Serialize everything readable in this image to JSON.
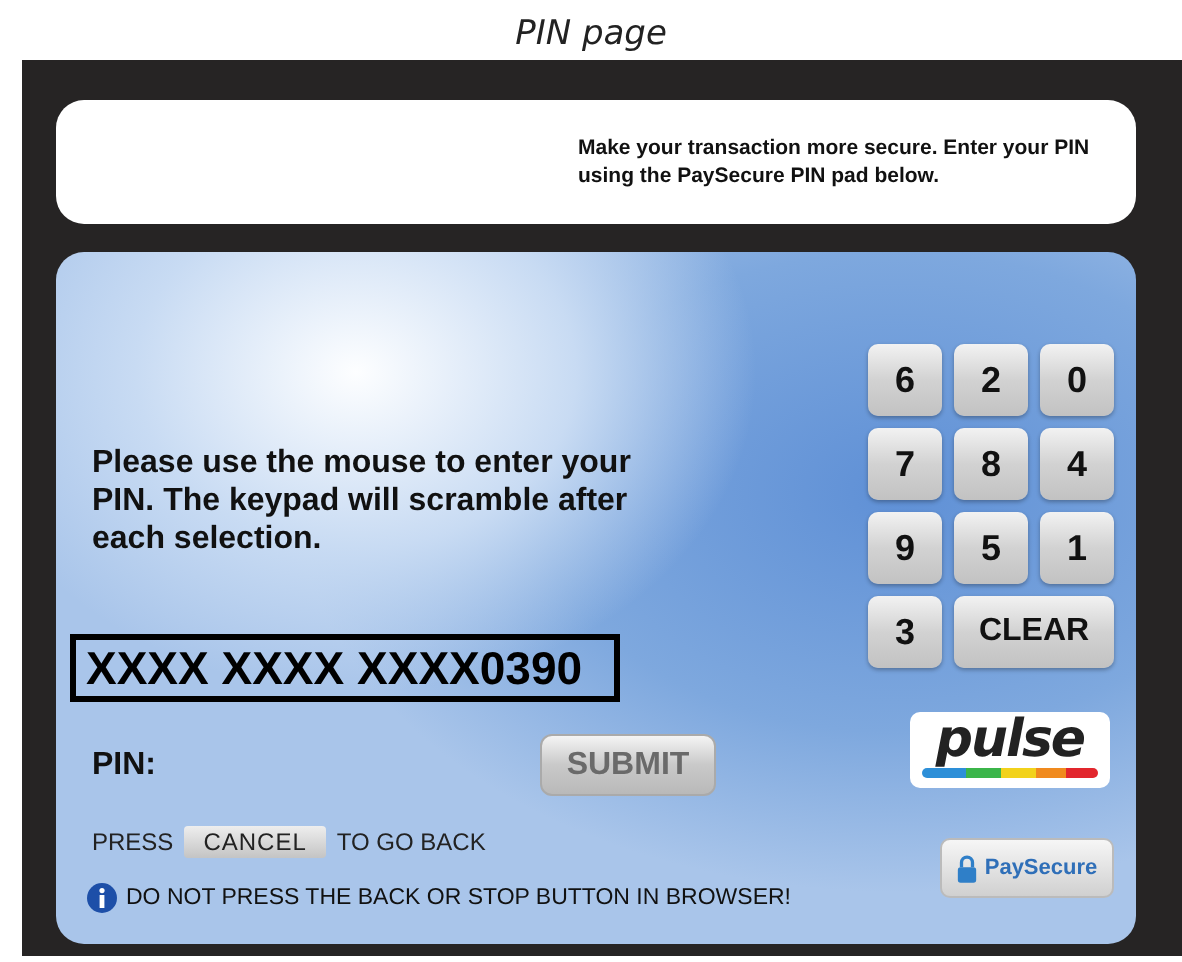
{
  "page_title": "PIN page",
  "notice": "Make your transaction more secure. Enter your PIN using the PaySecure PIN pad below.",
  "instructions": "Please use the mouse to enter your PIN. The keypad will scramble after each selection.",
  "keypad": [
    {
      "label": "6",
      "kind": "digit"
    },
    {
      "label": "2",
      "kind": "digit"
    },
    {
      "label": "0",
      "kind": "digit"
    },
    {
      "label": "7",
      "kind": "digit"
    },
    {
      "label": "8",
      "kind": "digit"
    },
    {
      "label": "4",
      "kind": "digit"
    },
    {
      "label": "9",
      "kind": "digit"
    },
    {
      "label": "5",
      "kind": "digit"
    },
    {
      "label": "1",
      "kind": "digit"
    },
    {
      "label": "3",
      "kind": "digit"
    },
    {
      "label": "CLEAR",
      "kind": "clear"
    }
  ],
  "card_number": "XXXX XXXX XXXX0390",
  "pin_label": "PIN:",
  "submit": {
    "label": "SUBMIT",
    "disabled": true
  },
  "logo": "pulse",
  "cancel_line": {
    "before": "PRESS",
    "button": "CANCEL",
    "after": "TO GO BACK"
  },
  "warning": "DO NOT PRESS THE BACK OR STOP BUTTON IN BROWSER!",
  "paysecure_button": "PaySecure"
}
